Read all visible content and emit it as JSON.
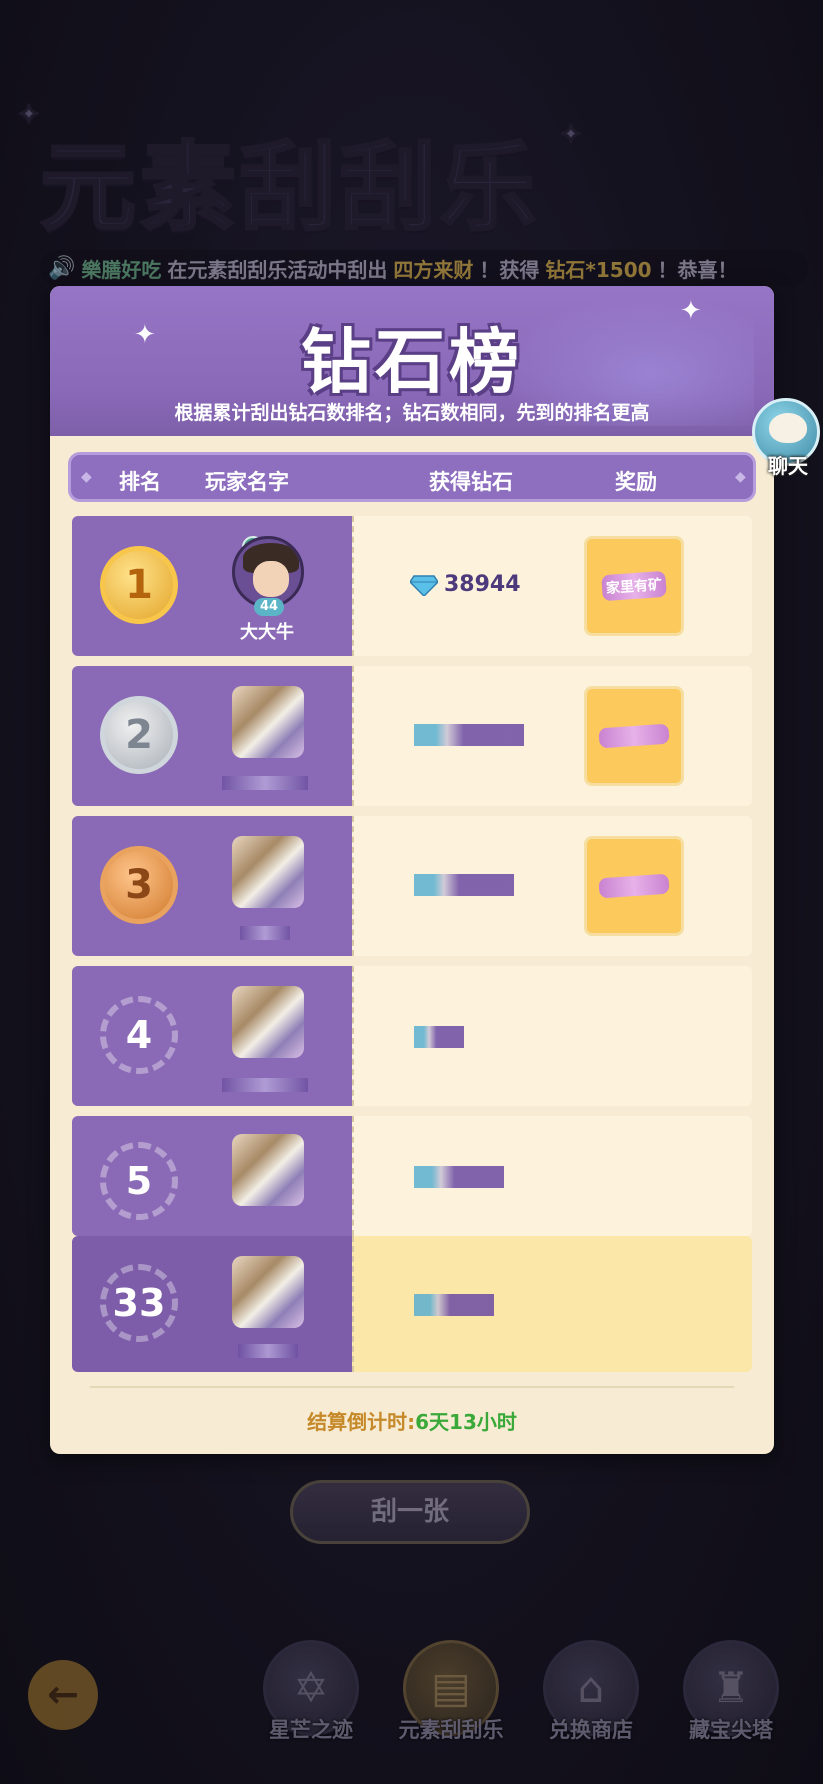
{
  "background": {
    "title": "元素刮刮乐",
    "ticker": {
      "player": "樂膳好吃",
      "text1": "在元素刮刮乐活动中刮出",
      "prize": "四方来财",
      "text2": "！获得",
      "reward": "钻石*1500",
      "text3": "！恭喜！"
    }
  },
  "chat": {
    "label": "聊天"
  },
  "panel": {
    "title": "钻石榜",
    "subtitle": "根据累计刮出钻石数排名；钻石数相同，先到的排名更高",
    "columns": {
      "rank": "排名",
      "player": "玩家名字",
      "diamonds": "获得钻石",
      "reward": "奖励"
    },
    "rows": [
      {
        "rank": "1",
        "name": "大大牛",
        "level": "44",
        "diamonds": "38944",
        "reward": "家里有矿"
      },
      {
        "rank": "2",
        "name": "",
        "level": "",
        "diamonds": "",
        "reward": ""
      },
      {
        "rank": "3",
        "name": "",
        "level": "",
        "diamonds": "",
        "reward": ""
      },
      {
        "rank": "4",
        "name": "",
        "level": "",
        "diamonds": "",
        "reward": ""
      },
      {
        "rank": "5",
        "name": "",
        "level": "",
        "diamonds": "",
        "reward": ""
      }
    ],
    "my_row": {
      "rank": "33"
    },
    "countdown_label": "结算倒计时:",
    "countdown_value": "6天13小时"
  },
  "actions": {
    "scratch": "刮一张"
  },
  "nav": [
    {
      "label": "星芒之迹",
      "icon": "star-emblem-icon"
    },
    {
      "label": "元素刮刮乐",
      "icon": "scratch-card-icon"
    },
    {
      "label": "兑换商店",
      "icon": "shop-icon"
    },
    {
      "label": "藏宝尖塔",
      "icon": "tower-icon"
    }
  ],
  "colors": {
    "panel_purple": "#8a6ab6",
    "panel_cream": "#f7ecd3",
    "gold": "#c6892a",
    "green": "#3aa93a"
  }
}
